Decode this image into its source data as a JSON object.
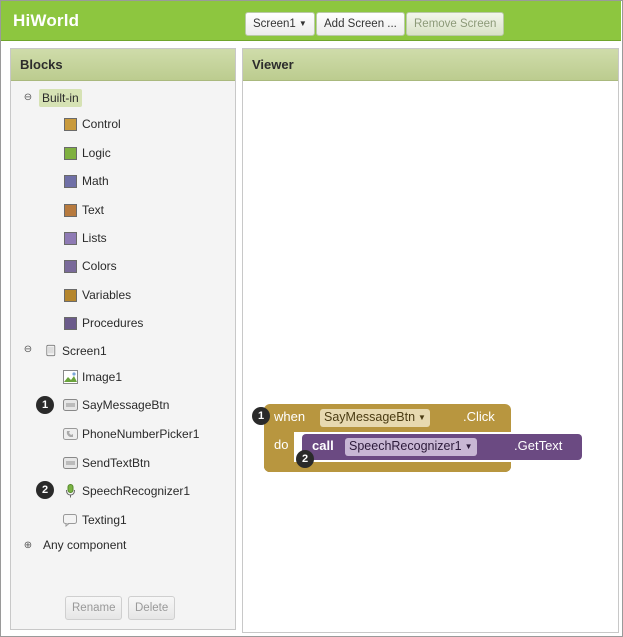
{
  "app": {
    "title": "HiWorld"
  },
  "toolbar": {
    "screen_select": "Screen1",
    "add_screen": "Add Screen ...",
    "remove_screen": "Remove Screen"
  },
  "blocks_panel": {
    "title": "Blocks",
    "builtin": {
      "label": "Built-in",
      "items": [
        {
          "label": "Control",
          "color": "#c99a3c"
        },
        {
          "label": "Logic",
          "color": "#7fb040"
        },
        {
          "label": "Math",
          "color": "#6f6fa6"
        },
        {
          "label": "Text",
          "color": "#b77a3e"
        },
        {
          "label": "Lists",
          "color": "#8e7ab4"
        },
        {
          "label": "Colors",
          "color": "#7a6a9a"
        },
        {
          "label": "Variables",
          "color": "#b5862e"
        },
        {
          "label": "Procedures",
          "color": "#6b5b8a"
        }
      ]
    },
    "screen": {
      "label": "Screen1",
      "components": [
        {
          "label": "Image1",
          "icon": "image-icon"
        },
        {
          "label": "SayMessageBtn",
          "icon": "button-icon",
          "badge": "1"
        },
        {
          "label": "PhoneNumberPicker1",
          "icon": "phone-picker-icon"
        },
        {
          "label": "SendTextBtn",
          "icon": "button-icon"
        },
        {
          "label": "SpeechRecognizer1",
          "icon": "microphone-icon",
          "badge": "2"
        },
        {
          "label": "Texting1",
          "icon": "texting-icon"
        }
      ]
    },
    "any_component": "Any component",
    "rename": "Rename",
    "delete": "Delete"
  },
  "viewer": {
    "title": "Viewer",
    "when_block": {
      "badge": "1",
      "when": "when",
      "component": "SayMessageBtn",
      "event": ".Click",
      "do": "do"
    },
    "call_block": {
      "badge": "2",
      "call": "call",
      "component": "SpeechRecognizer1",
      "method": ".GetText"
    }
  }
}
